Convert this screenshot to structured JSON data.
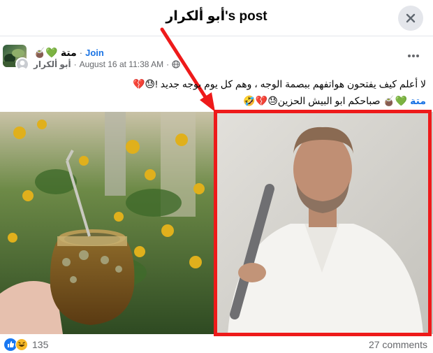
{
  "header": {
    "title": "أبو ألكرار's post"
  },
  "post": {
    "group_name": "متة",
    "group_emojis": "🧉💚",
    "separator": "·",
    "join_label": "Join",
    "author": "أبو ألكرار",
    "timestamp": "August 16 at 11:38 AM",
    "audience_icon": "globe-icon",
    "text_line1": "لا أعلم كيف يفتحون هواتفهم ببصمة الوجه ، وهم كل يوم بوجه جديد !😓💔",
    "hashtag": "متة",
    "text_line2_after_hashtag": "💚🧉 صباحكم ابو البيش الحزين😓💔🤣"
  },
  "footer": {
    "reaction_count": "135",
    "comments_label": "27 comments"
  },
  "colors": {
    "link_blue": "#1b74e4",
    "highlight_red": "#ee1a1a",
    "like_blue": "#1877f2"
  }
}
